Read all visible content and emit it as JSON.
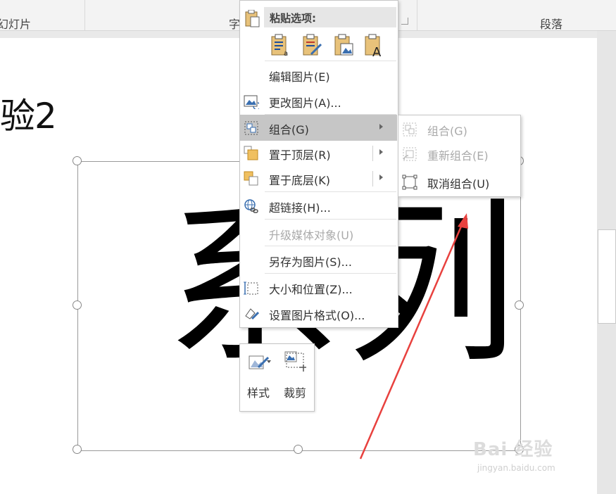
{
  "ribbon": {
    "group_slides": "幻灯片",
    "group_font": "字",
    "group_paragraph": "段落"
  },
  "slide": {
    "title": "验2",
    "big_text": "系列"
  },
  "context_menu": {
    "paste_header": "粘贴选项:",
    "paste_buttons": [
      "paste-keep-text-icon",
      "paste-format-icon",
      "paste-picture-icon",
      "paste-text-only-icon"
    ],
    "items": [
      {
        "label": "编辑图片(E)",
        "icon": "",
        "enabled": true,
        "submenu": false
      },
      {
        "label": "更改图片(A)...",
        "icon": "change-picture-icon",
        "enabled": true,
        "submenu": false
      },
      {
        "label": "组合(G)",
        "icon": "group-icon",
        "enabled": true,
        "submenu": true,
        "highlighted": true
      },
      {
        "label": "置于顶层(R)",
        "icon": "bring-to-front-icon",
        "enabled": true,
        "submenu": true
      },
      {
        "label": "置于底层(K)",
        "icon": "send-to-back-icon",
        "enabled": true,
        "submenu": true
      },
      {
        "label": "超链接(H)...",
        "icon": "hyperlink-icon",
        "enabled": true,
        "submenu": false
      },
      {
        "label": "升级媒体对象(U)",
        "icon": "",
        "enabled": false,
        "submenu": false
      },
      {
        "label": "另存为图片(S)...",
        "icon": "",
        "enabled": true,
        "submenu": false
      },
      {
        "label": "大小和位置(Z)...",
        "icon": "size-position-icon",
        "enabled": true,
        "submenu": false
      },
      {
        "label": "设置图片格式(O)...",
        "icon": "format-picture-icon",
        "enabled": true,
        "submenu": false
      }
    ]
  },
  "group_submenu": {
    "items": [
      {
        "label": "组合(G)",
        "icon": "group-icon",
        "enabled": false
      },
      {
        "label": "重新组合(E)",
        "icon": "regroup-icon",
        "enabled": false
      },
      {
        "label": "取消组合(U)",
        "icon": "ungroup-icon",
        "enabled": true
      }
    ]
  },
  "mini_toolbar": {
    "style_label": "样式",
    "crop_label": "裁剪"
  },
  "watermark": {
    "brand": "Bai 经验",
    "url": "jingyan.baidu.com"
  },
  "colors": {
    "highlight": "#c6c6c6",
    "arrow": "#e8413e",
    "disabled_text": "#aaaaaa"
  }
}
